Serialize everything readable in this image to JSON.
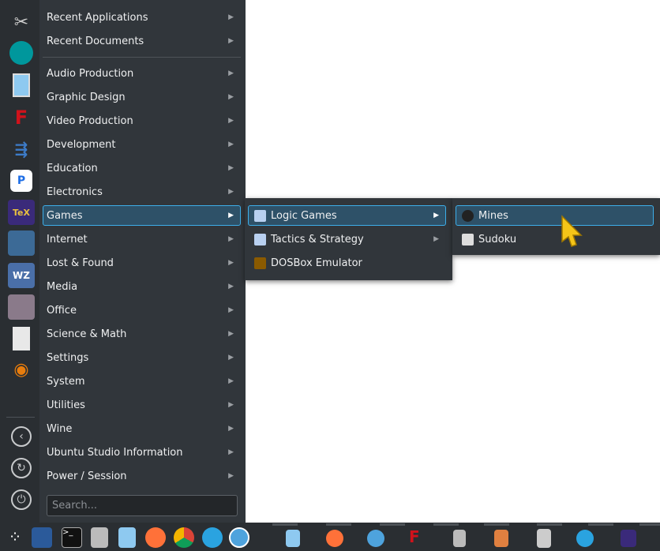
{
  "favorites": [
    {
      "name": "system-settings",
      "color": "#b0b4b8"
    },
    {
      "name": "arduino",
      "color": "#00979c"
    },
    {
      "name": "file-manager",
      "color": "#8ec9f0"
    },
    {
      "name": "fontforge",
      "color": "#d0121b"
    },
    {
      "name": "kdeconnect",
      "color": "#3d7cc9"
    },
    {
      "name": "app",
      "color": "#1e6ee6"
    },
    {
      "name": "texstudio",
      "color": "#3a2a7a"
    },
    {
      "name": "video-editor",
      "color": "#3c6a96"
    },
    {
      "name": "webcamoid",
      "color": "#4a6fa8"
    },
    {
      "name": "screen-recorder",
      "color": "#8a7a8a"
    },
    {
      "name": "text-document",
      "color": "#e8e8e8"
    },
    {
      "name": "blender",
      "color": "#e87d0d"
    }
  ],
  "menu": {
    "top": [
      "Recent Applications",
      "Recent Documents"
    ],
    "categories": [
      "Audio Production",
      "Graphic Design",
      "Video Production",
      "Development",
      "Education",
      "Electronics",
      "Games",
      "Internet",
      "Lost & Found",
      "Media",
      "Office",
      "Science & Math",
      "Settings",
      "System",
      "Utilities",
      "Wine",
      "Ubuntu Studio Information",
      "Power / Session"
    ],
    "search_placeholder": "Search..."
  },
  "games_submenu": [
    "Logic Games",
    "Tactics & Strategy",
    "DOSBox Emulator"
  ],
  "logic_submenu": [
    "Mines",
    "Sudoku"
  ],
  "accent": "#3daee9"
}
